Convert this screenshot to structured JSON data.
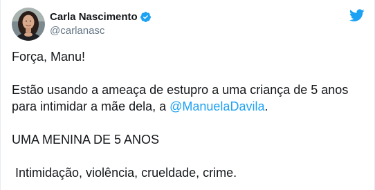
{
  "author": {
    "name": "Carla Nascimento",
    "handle": "@carlanasc",
    "verified": true,
    "verified_color": "#1da1f2"
  },
  "brand": {
    "icon": "twitter-bird-icon",
    "color": "#1da1f2"
  },
  "tweet": {
    "line1": "Força, Manu!",
    "line2_text": "Estão usando a ameaça de estupro a uma criança de 5 anos para intimidar a mãe dela, a ",
    "line2_mention": "@ManuelaDavila",
    "line2_end": ".",
    "line3": "UMA MENINA DE 5 ANOS",
    "line4": "Intimidação, violência, crueldade, crime."
  },
  "colors": {
    "text": "#14171a",
    "secondary": "#657786",
    "link": "#1da1f2"
  }
}
